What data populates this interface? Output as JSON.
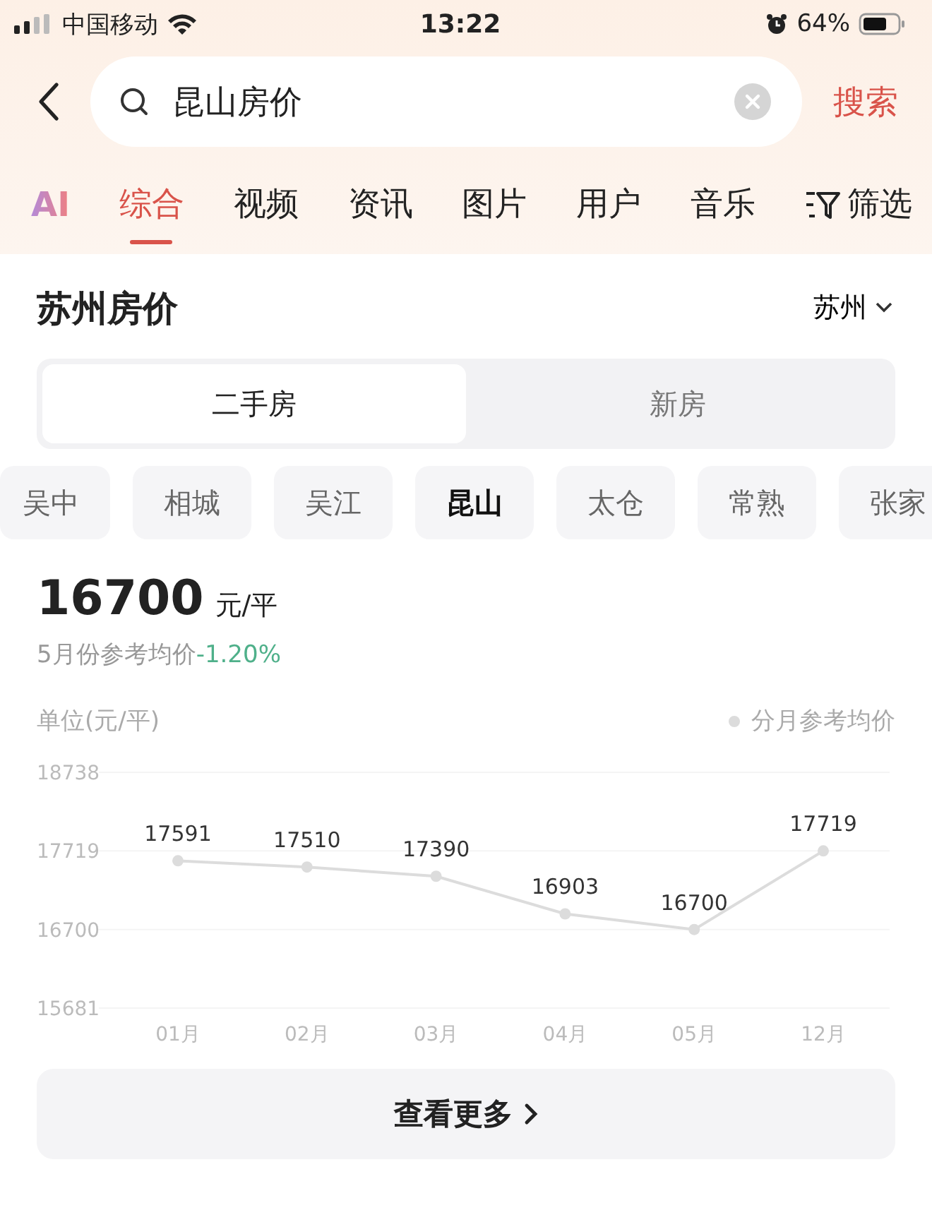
{
  "status_bar": {
    "carrier": "中国移动",
    "time": "13:22",
    "battery": "64%"
  },
  "search": {
    "value": "昆山房价",
    "submit": "搜索"
  },
  "tabs": [
    {
      "label": "AI",
      "kind": "ai",
      "selected": false
    },
    {
      "label": "综合",
      "kind": "text",
      "selected": true
    },
    {
      "label": "视频",
      "kind": "text",
      "selected": false
    },
    {
      "label": "资讯",
      "kind": "text",
      "selected": false
    },
    {
      "label": "图片",
      "kind": "text",
      "selected": false
    },
    {
      "label": "用户",
      "kind": "text",
      "selected": false
    },
    {
      "label": "音乐",
      "kind": "text",
      "selected": false
    },
    {
      "label": "筛选",
      "kind": "filter",
      "selected": false
    }
  ],
  "card": {
    "title": "苏州房价",
    "city": "苏州",
    "segments": [
      {
        "label": "二手房",
        "selected": true
      },
      {
        "label": "新房",
        "selected": false
      }
    ],
    "districts": [
      {
        "label": "吴中",
        "selected": false
      },
      {
        "label": "相城",
        "selected": false
      },
      {
        "label": "吴江",
        "selected": false
      },
      {
        "label": "昆山",
        "selected": true
      },
      {
        "label": "太仓",
        "selected": false
      },
      {
        "label": "常熟",
        "selected": false
      },
      {
        "label": "张家",
        "selected": false
      }
    ],
    "price": "16700",
    "unit": "元/平",
    "note": "5月份参考均价",
    "change": "-1.20%",
    "unit_label": "单位(元/平)",
    "chart_data": {
      "type": "line",
      "categories": [
        "01月",
        "02月",
        "03月",
        "04月",
        "05月",
        "12月"
      ],
      "series": [
        {
          "name": "分月参考均价",
          "color": "#dcdcdc",
          "marker": "circle",
          "values": [
            17591,
            17510,
            17390,
            16903,
            16700,
            17719
          ]
        }
      ],
      "ylim": [
        15681,
        18738
      ],
      "yticks": [
        15681,
        16700,
        17719,
        18738
      ],
      "data_labels": true
    },
    "more": "查看更多"
  }
}
